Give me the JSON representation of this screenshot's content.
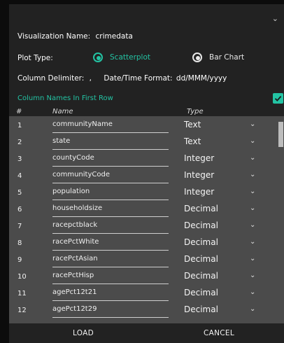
{
  "dialog": {
    "viz_name_label": "Visualization Name:",
    "viz_name_value": "crimedata",
    "plot_type_label": "Plot Type:",
    "plot_options": [
      "Scatterplot",
      "Bar Chart"
    ],
    "selected_plot": "Scatterplot",
    "delimiter_label": "Column Delimiter:",
    "delimiter_value": ",",
    "date_format_label": "Date/Time Format:",
    "date_format_value": "dd/MMM/yyyy",
    "column_names_first_row_label": "Column Names In First Row",
    "column_names_first_row_checked": true,
    "accent_color": "#23c3a3",
    "columns_header": {
      "num": "#",
      "name": "Name",
      "type": "Type"
    },
    "rows": [
      {
        "num": "1",
        "name": "communityName",
        "type": "Text"
      },
      {
        "num": "2",
        "name": "state",
        "type": "Text"
      },
      {
        "num": "3",
        "name": "countyCode",
        "type": "Integer"
      },
      {
        "num": "4",
        "name": "communityCode",
        "type": "Integer"
      },
      {
        "num": "5",
        "name": "population",
        "type": "Integer"
      },
      {
        "num": "6",
        "name": "householdsize",
        "type": "Decimal"
      },
      {
        "num": "7",
        "name": "racepctblack",
        "type": "Decimal"
      },
      {
        "num": "8",
        "name": "racePctWhite",
        "type": "Decimal"
      },
      {
        "num": "9",
        "name": "racePctAsian",
        "type": "Decimal"
      },
      {
        "num": "10",
        "name": "racePctHisp",
        "type": "Decimal"
      },
      {
        "num": "11",
        "name": "agePct12t21",
        "type": "Decimal"
      },
      {
        "num": "12",
        "name": "agePct12t29",
        "type": "Decimal"
      }
    ],
    "buttons": {
      "load": "LOAD",
      "cancel": "CANCEL"
    }
  }
}
